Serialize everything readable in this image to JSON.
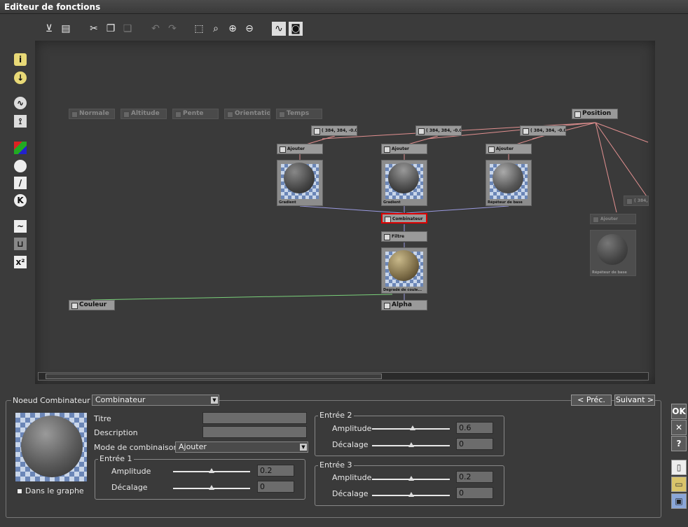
{
  "window": {
    "title": "Editeur de fonctions"
  },
  "graph": {
    "input_nodes": [
      "Normale",
      "Altitude",
      "Pente",
      "Orientation",
      "Temps"
    ],
    "position_node": "Position",
    "value_nodes": [
      "( 384, 384, -0.0...",
      "( 384, 384, -0.0...",
      "( 384, 384, -0.0...",
      "( 384, 384..."
    ],
    "add_nodes": [
      "Ajouter",
      "Ajouter",
      "Ajouter",
      "Ajouter"
    ],
    "thumbs": [
      "Gradient",
      "Gradient",
      "Répéteur de base",
      "Degradé de coule...",
      "Répéteur de base"
    ],
    "combiner_node": "Combinateur",
    "filter_node": "Filtre",
    "color_output": "Couleur",
    "alpha_output": "Alpha"
  },
  "panel": {
    "node_label": "Noeud Combinateur",
    "node_select": "Combinateur",
    "prev_label": "< Préc.",
    "next_label": "Suivant >",
    "title_label": "Titre",
    "title_value": "",
    "desc_label": "Description",
    "desc_value": "",
    "mode_label": "Mode de combinaison",
    "mode_value": "Ajouter",
    "in_graph_label": "Dans le graphe",
    "amplitude_label": "Amplitude",
    "offset_label": "Décalage",
    "inputs": [
      {
        "title": "Entrée 1",
        "amplitude": "0.2",
        "offset": "0",
        "amp_pos": 0.5,
        "off_pos": 0.5
      },
      {
        "title": "Entrée 2",
        "amplitude": "0.6",
        "offset": "0",
        "amp_pos": 0.52,
        "off_pos": 0.5
      },
      {
        "title": "Entrée 3",
        "amplitude": "0.2",
        "offset": "0",
        "amp_pos": 0.5,
        "off_pos": 0.5
      }
    ]
  },
  "right_buttons": {
    "ok": "OK",
    "cancel": "✕",
    "help": "?"
  },
  "colors": {
    "accent_red": "#dd0000",
    "link_pink": "#e29090",
    "link_blue": "#9a9ae0",
    "link_green": "#7ad07a"
  }
}
